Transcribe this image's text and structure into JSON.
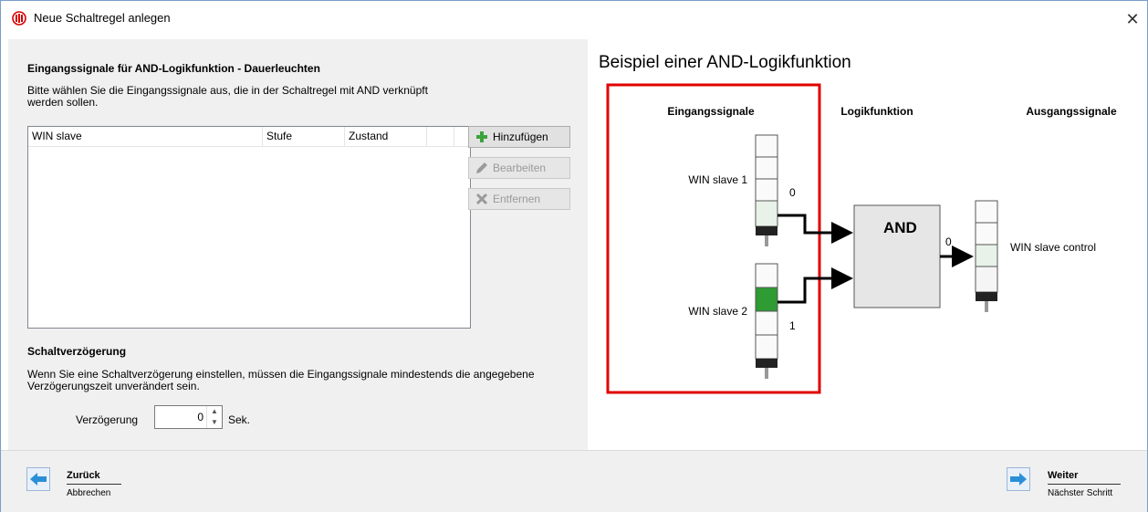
{
  "window": {
    "title": "Neue Schaltregel anlegen",
    "close_glyph": "✕"
  },
  "left": {
    "section_title": "Eingangssignale für AND-Logikfunktion - Dauerleuchten",
    "description_line1": "Bitte wählen Sie die Eingangssignale aus, die in der Schaltregel mit AND verknüpft",
    "description_line2": "werden sollen.",
    "table": {
      "columns": [
        "WIN slave",
        "Stufe",
        "Zustand",
        ""
      ],
      "rows": []
    },
    "buttons": {
      "add": "Hinzufügen",
      "edit": "Bearbeiten",
      "remove": "Entfernen"
    },
    "delay": {
      "title": "Schaltverzögerung",
      "description_line1": "Wenn Sie eine Schaltverzögerung einstellen, müssen die Eingangssignale mindestends die angegebene",
      "description_line2": "Verzögerungszeit unverändert sein.",
      "label": "Verzögerung",
      "value": "0",
      "unit": "Sek."
    }
  },
  "diagram": {
    "title": "Beispiel einer AND-Logikfunktion",
    "col_inputs": "Eingangssignale",
    "col_logic": "Logikfunktion",
    "col_outputs": "Ausgangssignale",
    "input1_label": "WIN slave 1",
    "input1_value": "0",
    "input2_label": "WIN slave 2",
    "input2_value": "1",
    "gate_label": "AND",
    "output_value": "0",
    "output_label": "WIN slave control",
    "highlight_color": "#e00000",
    "active_segment_color": "#2e9b33",
    "idle_segment_color": "#e8f2e8"
  },
  "footer": {
    "back_label": "Zurück",
    "back_sub": "Abbrechen",
    "next_label": "Weiter",
    "next_sub": "Nächster Schritt"
  }
}
